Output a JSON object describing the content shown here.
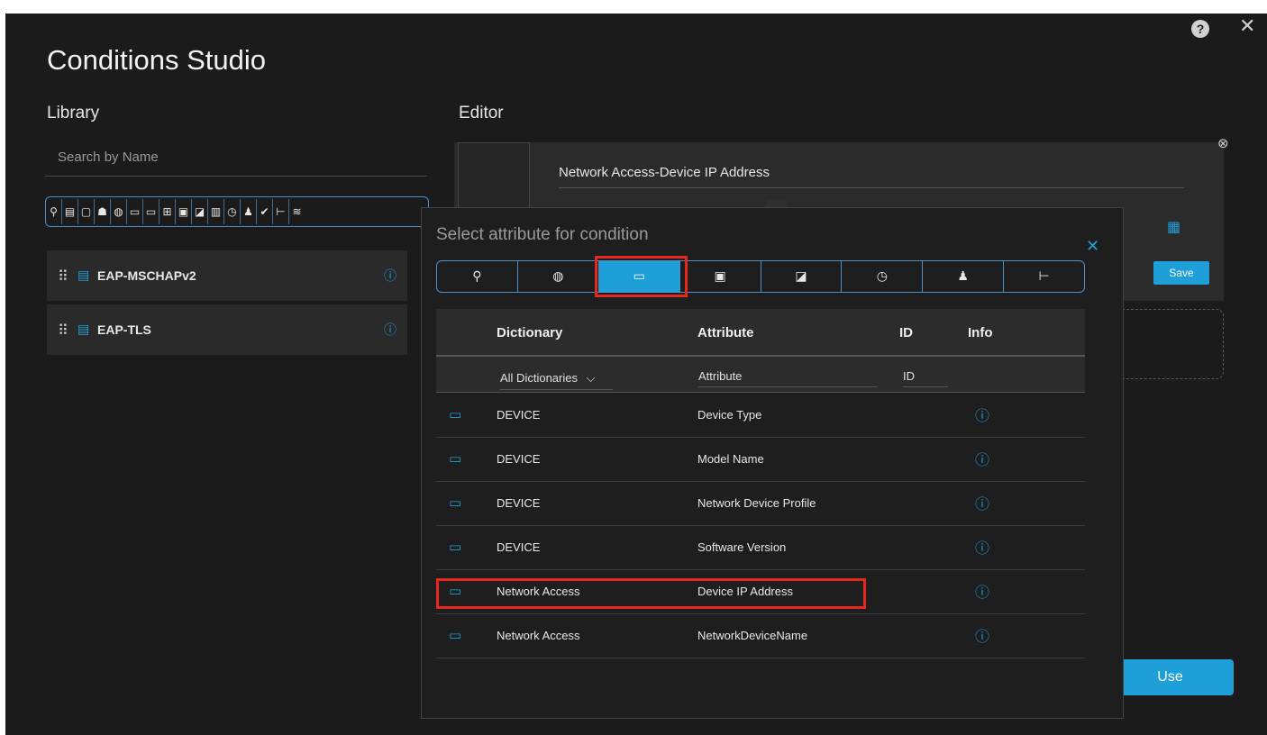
{
  "window": {
    "title": "Conditions Studio",
    "help_icon": "?",
    "close_icon": "✕"
  },
  "library": {
    "label": "Library",
    "search_placeholder": "Search by Name",
    "filter_icons": [
      "location-icon",
      "tag-icon",
      "square-icon",
      "group-icon",
      "globe-icon",
      "monitor-icon",
      "monitor-alt-icon",
      "network-icon",
      "card-icon",
      "edit-icon",
      "building-icon",
      "clock-icon",
      "user-icon",
      "check-icon",
      "tree-icon",
      "wifi-icon"
    ],
    "items": [
      {
        "label": "EAP-MSCHAPv2"
      },
      {
        "label": "EAP-TLS"
      }
    ]
  },
  "editor": {
    "label": "Editor",
    "field_value": "Network Access-Device IP Address",
    "save_label": "Save",
    "use_label": "Use"
  },
  "popup": {
    "title": "Select attribute for condition",
    "tabs": [
      "location-icon",
      "globe-icon",
      "device-icon",
      "card-icon",
      "edit-icon",
      "clock-icon",
      "user-icon",
      "tree-icon"
    ],
    "active_tab": 2,
    "columns": {
      "dictionary": "Dictionary",
      "attribute": "Attribute",
      "id": "ID",
      "info": "Info"
    },
    "filters": {
      "dictionary": "All Dictionaries",
      "attribute": "Attribute",
      "id": "ID"
    },
    "rows": [
      {
        "dictionary": "DEVICE",
        "attribute": "Device Type"
      },
      {
        "dictionary": "DEVICE",
        "attribute": "Model Name"
      },
      {
        "dictionary": "DEVICE",
        "attribute": "Network Device Profile"
      },
      {
        "dictionary": "DEVICE",
        "attribute": "Software Version"
      },
      {
        "dictionary": "Network Access",
        "attribute": "Device IP Address"
      },
      {
        "dictionary": "Network Access",
        "attribute": "NetworkDeviceName"
      }
    ],
    "highlighted_row": 4
  },
  "colors": {
    "accent": "#1f9fd8",
    "highlight": "#e5271c",
    "background": "#1b1b1b"
  }
}
